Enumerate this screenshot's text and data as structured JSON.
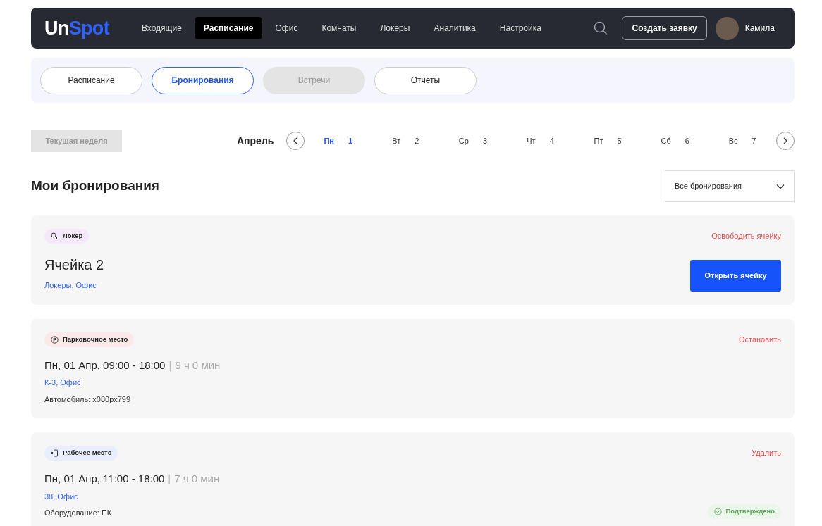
{
  "logo": {
    "part_1": "Un",
    "part_2": "Spot"
  },
  "nav": [
    {
      "label": "Входящие",
      "selected": false
    },
    {
      "label": "Расписание",
      "selected": true
    },
    {
      "label": "Офис",
      "selected": false
    },
    {
      "label": "Комнаты",
      "selected": false
    },
    {
      "label": "Локеры",
      "selected": false
    },
    {
      "label": "Аналитика",
      "selected": false
    },
    {
      "label": "Настройка",
      "selected": false
    }
  ],
  "create_button": "Создать заявку",
  "user": {
    "name": "Камила"
  },
  "subtabs": [
    {
      "label": "Расписание",
      "selected": false,
      "disabled": false
    },
    {
      "label": "Бронирования",
      "selected": true,
      "disabled": false
    },
    {
      "label": "Встречи",
      "selected": false,
      "disabled": true
    },
    {
      "label": "Отчеты",
      "selected": false,
      "disabled": false
    }
  ],
  "current_week_button": "Текущая неделя",
  "month": "Апрель",
  "days": [
    {
      "weekday": "Пн",
      "date": "1",
      "selected": true
    },
    {
      "weekday": "Вт",
      "date": "2",
      "selected": false
    },
    {
      "weekday": "Ср",
      "date": "3",
      "selected": false
    },
    {
      "weekday": "Чт",
      "date": "4",
      "selected": false
    },
    {
      "weekday": "Пт",
      "date": "5",
      "selected": false
    },
    {
      "weekday": "Сб",
      "date": "6",
      "selected": false
    },
    {
      "weekday": "Вс",
      "date": "7",
      "selected": false
    }
  ],
  "heading": "Мои бронирования",
  "filter": {
    "value": "Все бронирования"
  },
  "bookings": [
    {
      "kind": "locker",
      "tag": "Локер",
      "color": "#f6e8fb",
      "action": "Освободить ячейку",
      "title": "Ячейка 2",
      "location": "Локеры, Офис",
      "button": "Открыть ячейку"
    },
    {
      "kind": "parking",
      "tag": "Парковочное место",
      "color": "#fbe9e9",
      "action": "Остановить",
      "title": "Пн, 01 Апр, 09:00 - 18:00",
      "separator": "|",
      "duration": "9 ч 0 мин",
      "location": "К-3, Офис",
      "detail": "Автомобиль: х080рх799"
    },
    {
      "kind": "workplace",
      "tag": "Рабочее место",
      "color": "#e8eefb",
      "action": "Удалить",
      "title": "Пн, 01 Апр, 11:00 - 18:00",
      "separator": "|",
      "duration": "7 ч 0 мин",
      "location": "38, Офис",
      "detail": "Оборудование: ПК",
      "status": "Подтверждено"
    }
  ]
}
